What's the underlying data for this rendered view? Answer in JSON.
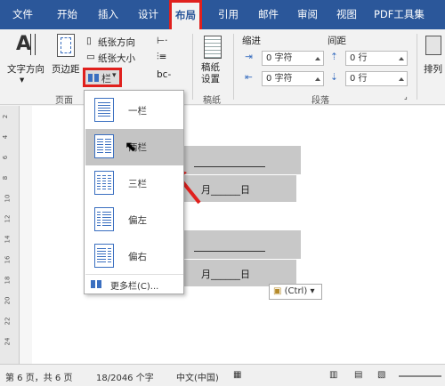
{
  "tabs": [
    "文件",
    "开始",
    "插入",
    "设计",
    "布局",
    "引用",
    "邮件",
    "审阅",
    "视图",
    "PDF工具集"
  ],
  "ribbon": {
    "text_direction": "文字方向",
    "margins": "页边距",
    "orientation": "纸张方向",
    "size": "纸张大小",
    "columns": "栏",
    "group_page": "页面",
    "manuscript_setup": "稿纸\n设置",
    "group_manuscript": "稿纸",
    "indent_label": "缩进",
    "spacing_label": "间距",
    "indent_left": "0 字符",
    "indent_right": "0 字符",
    "spacing_before": "0 行",
    "spacing_after": "0 行",
    "group_paragraph": "段落",
    "arrange": "排列"
  },
  "columns_menu": {
    "items": [
      "一栏",
      "两栏",
      "三栏",
      "偏左",
      "偏右"
    ],
    "selected_index": 1,
    "more": "更多栏(C)..."
  },
  "document": {
    "month_day": "月______日",
    "month_day2": "月______日",
    "paste_options": "(Ctrl)"
  },
  "ruler_marks": [
    "2",
    "4",
    "6",
    "8",
    "10",
    "12",
    "14",
    "16",
    "18",
    "20",
    "22",
    "24"
  ],
  "status": {
    "page": "第 6 页，共 6 页",
    "words": "18/2046 个字",
    "language": "中文(中国)"
  },
  "colors": {
    "accent": "#2b579a",
    "highlight": "#e0201d"
  }
}
